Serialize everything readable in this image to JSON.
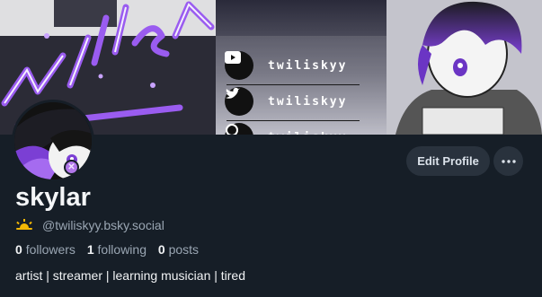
{
  "banner": {
    "logo_text": "twiliskyy",
    "socials": [
      {
        "platform": "youtube-icon",
        "handle": "twiliskyy"
      },
      {
        "platform": "twitter-icon",
        "handle": "twiliskyy"
      },
      {
        "platform": "twitch-icon",
        "handle": "twiliskyy"
      }
    ]
  },
  "profile": {
    "display_name": "skylar",
    "handle": "@twiliskyy.bsky.social",
    "handle_icon": "sunrise-icon",
    "stats": {
      "followers_count": "0",
      "followers_label": "followers",
      "following_count": "1",
      "following_label": "following",
      "posts_count": "0",
      "posts_label": "posts"
    },
    "bio": "artist | streamer | learning musician | tired"
  },
  "actions": {
    "edit_profile_label": "Edit Profile",
    "more_icon": "ellipsis-icon"
  },
  "colors": {
    "background": "#161e27",
    "button": "#29323d",
    "accent_purple": "#8a4fe0",
    "muted_text": "#9aa6b3"
  }
}
